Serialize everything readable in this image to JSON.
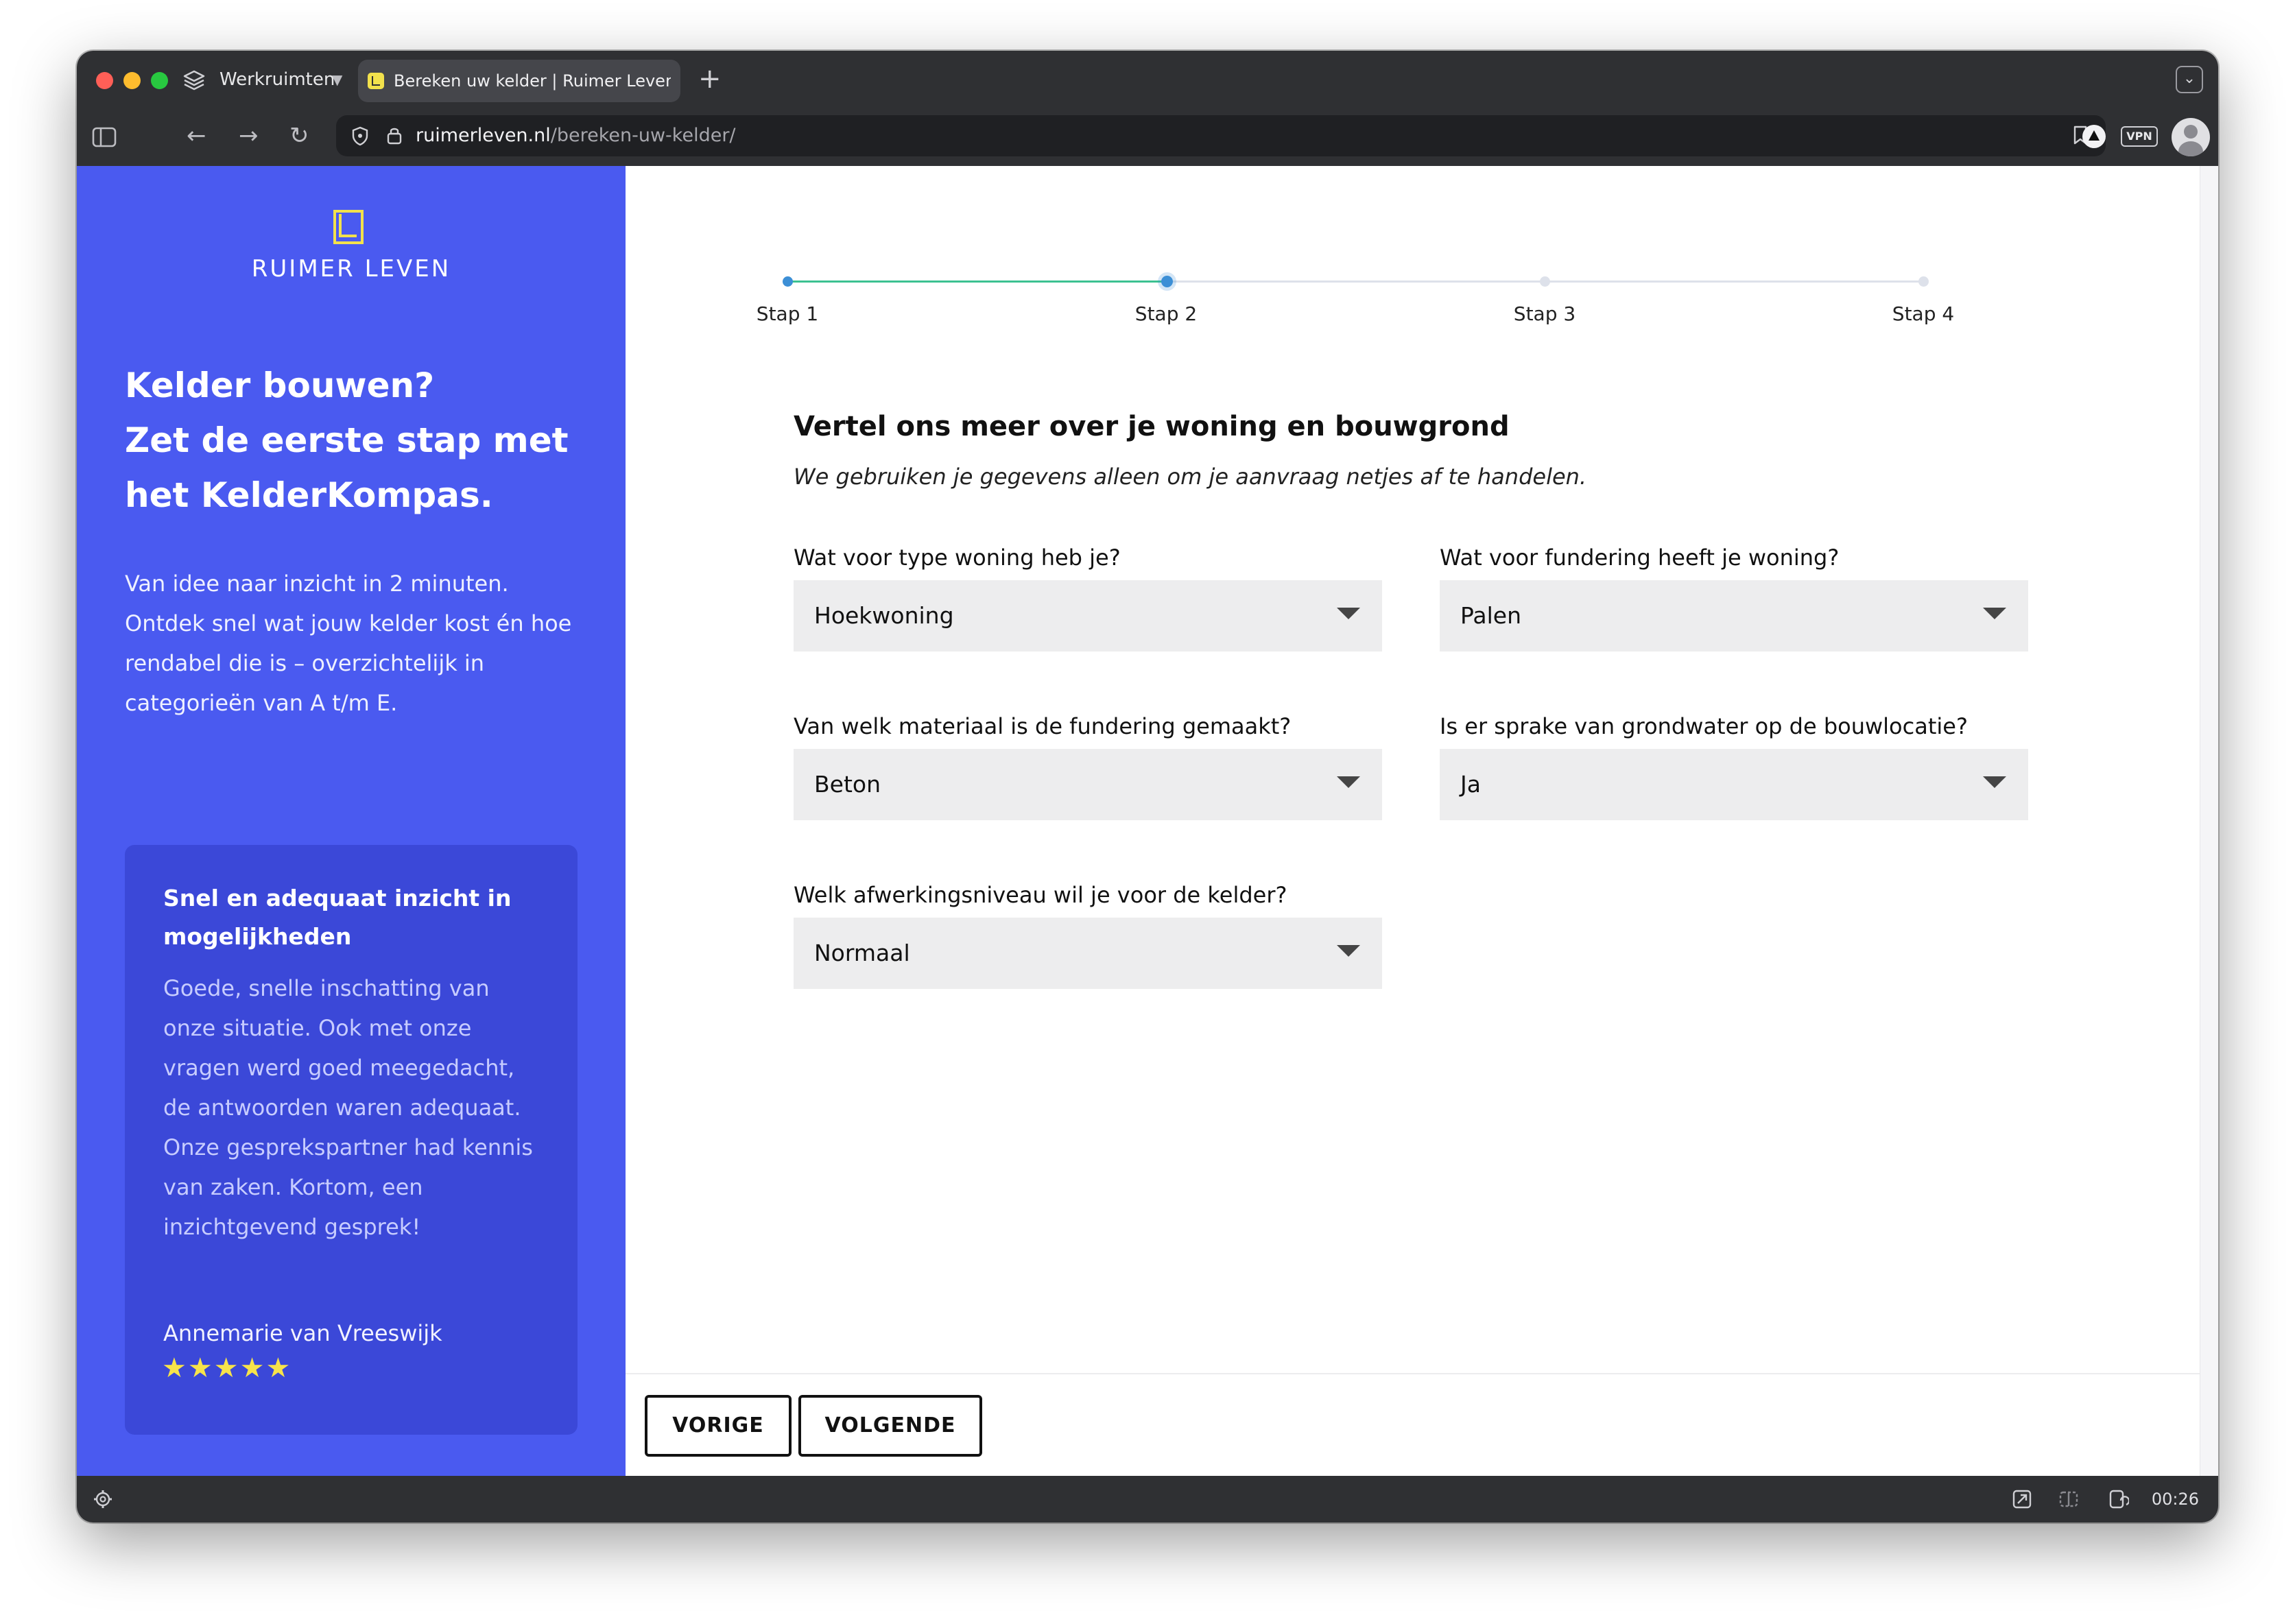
{
  "browser": {
    "workspace_label": "Werkruimten",
    "tab_title": "Bereken uw kelder | Ruimer Leven",
    "url_domain": "ruimerleven.nl",
    "url_path": "/bereken-uw-kelder/",
    "vpn_label": "VPN",
    "time": "00:26"
  },
  "sidebar": {
    "logo_text": "RUIMER LEVEN",
    "hero_line1": "Kelder bouwen?",
    "hero_line2": "Zet de eerste stap met het KelderKompas.",
    "description": "Van idee naar inzicht in 2 minuten. Ontdek snel wat jouw kelder kost én hoe rendabel die is – overzichtelijk in categorieën van A t/m E.",
    "testimonial": {
      "heading": "Snel en adequaat inzicht in mogelijkheden",
      "body": "Goede, snelle inschatting van onze situatie. Ook met onze vragen werd goed meegedacht, de antwoorden waren adequaat. Onze gesprekspartner had kennis van zaken. Kortom, een inzichtgevend gesprek!",
      "author": "Annemarie van Vreeswijk",
      "stars_text": "★★★★★",
      "rating": 5
    }
  },
  "steps": {
    "current": 2,
    "labels": [
      "Stap 1",
      "Stap 2",
      "Stap 3",
      "Stap 4"
    ]
  },
  "form": {
    "title": "Vertel ons meer over je woning en bouwgrond",
    "subtitle": "We gebruiken je gegevens alleen om je aanvraag netjes af te handelen.",
    "fields": [
      {
        "label": "Wat voor type woning heb je?",
        "value": "Hoekwoning"
      },
      {
        "label": "Wat voor fundering heeft je woning?",
        "value": "Palen"
      },
      {
        "label": "Van welk materiaal is de fundering gemaakt?",
        "value": "Beton"
      },
      {
        "label": "Is er sprake van grondwater op de bouwlocatie?",
        "value": "Ja"
      },
      {
        "label": "Welk afwerkingsniveau wil je voor de kelder?",
        "value": "Normaal"
      }
    ]
  },
  "buttons": {
    "prev": "VORIGE",
    "next": "VOLGENDE"
  },
  "colors": {
    "sidebar_bg": "#4a5af0",
    "testimonial_bg": "#3b48d8",
    "logo_accent": "#f2e14c",
    "step_done": "#3cc191",
    "step_active": "#3c8fd6"
  }
}
